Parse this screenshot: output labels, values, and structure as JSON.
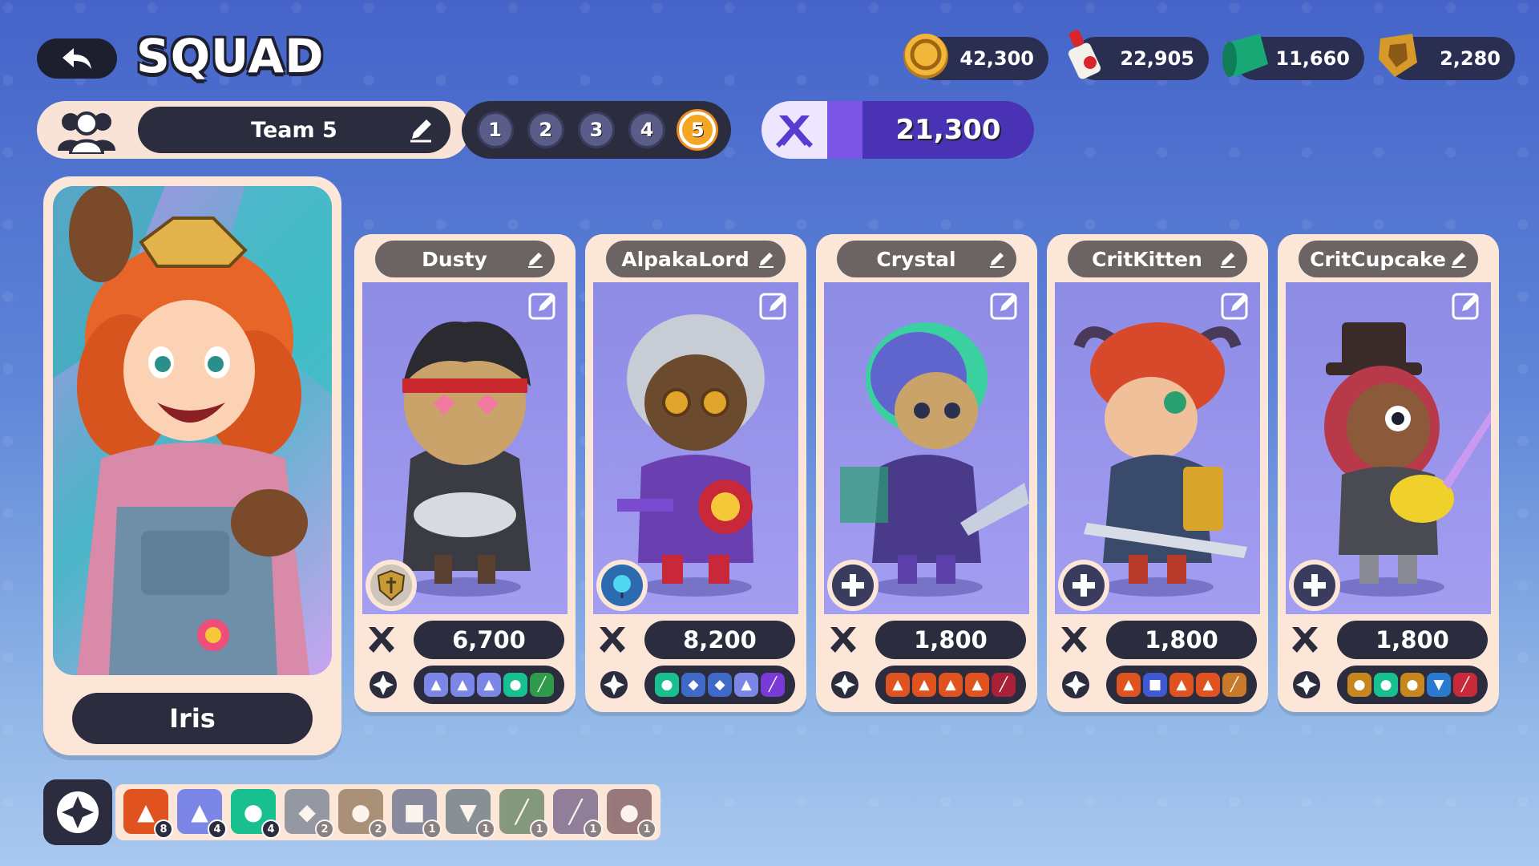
{
  "header": {
    "title": "SQUAD"
  },
  "currencies": [
    {
      "name": "coin-icon",
      "amount": "42,300"
    },
    {
      "name": "glue-icon",
      "amount": "22,905"
    },
    {
      "name": "fabric-icon",
      "amount": "11,660"
    },
    {
      "name": "badge-icon",
      "amount": "2,280"
    }
  ],
  "team": {
    "name": "Team 5",
    "slots": [
      "1",
      "2",
      "3",
      "4",
      "5"
    ],
    "active_slot": "5",
    "total_power": "21,300"
  },
  "leader": {
    "name": "Iris"
  },
  "cards": [
    {
      "name": "Dusty",
      "power": "6,700",
      "badge": "shield-icon",
      "synergies": [
        "shirt",
        "shirt",
        "shirt",
        "cat",
        "blade"
      ]
    },
    {
      "name": "AlpakaLord",
      "power": "8,200",
      "badge": "orb-icon",
      "synergies": [
        "cat",
        "crest",
        "crest",
        "shirt",
        "wand"
      ]
    },
    {
      "name": "Crystal",
      "power": "1,800",
      "badge": "plus-icon",
      "synergies": [
        "dino",
        "dino",
        "dino",
        "dino",
        "wand"
      ]
    },
    {
      "name": "CritKitten",
      "power": "1,800",
      "badge": "plus-icon",
      "synergies": [
        "dino",
        "gun",
        "dino",
        "dino",
        "feather"
      ]
    },
    {
      "name": "CritCupcake",
      "power": "1,800",
      "badge": "plus-icon",
      "synergies": [
        "hat",
        "cat",
        "hat",
        "shield",
        "blade"
      ]
    }
  ],
  "synergy_tray": [
    {
      "icon": "dino-icon",
      "count": "8",
      "color": "#e0531f"
    },
    {
      "icon": "shirt-icon",
      "count": "4",
      "color": "#7b86e6"
    },
    {
      "icon": "cat-icon",
      "count": "4",
      "color": "#19c08f"
    },
    {
      "icon": "crest-icon",
      "count": "2",
      "color": "#3f5a78"
    },
    {
      "icon": "hat-icon",
      "count": "2",
      "color": "#6b4a2a"
    },
    {
      "icon": "gun-icon",
      "count": "1",
      "color": "#2d3f70"
    },
    {
      "icon": "shield-icon",
      "count": "1",
      "color": "#2a4a60"
    },
    {
      "icon": "blade-icon",
      "count": "1",
      "color": "#245a35"
    },
    {
      "icon": "wand-icon",
      "count": "1",
      "color": "#3c2a66"
    },
    {
      "icon": "mace-icon",
      "count": "1",
      "color": "#4a2030"
    }
  ]
}
